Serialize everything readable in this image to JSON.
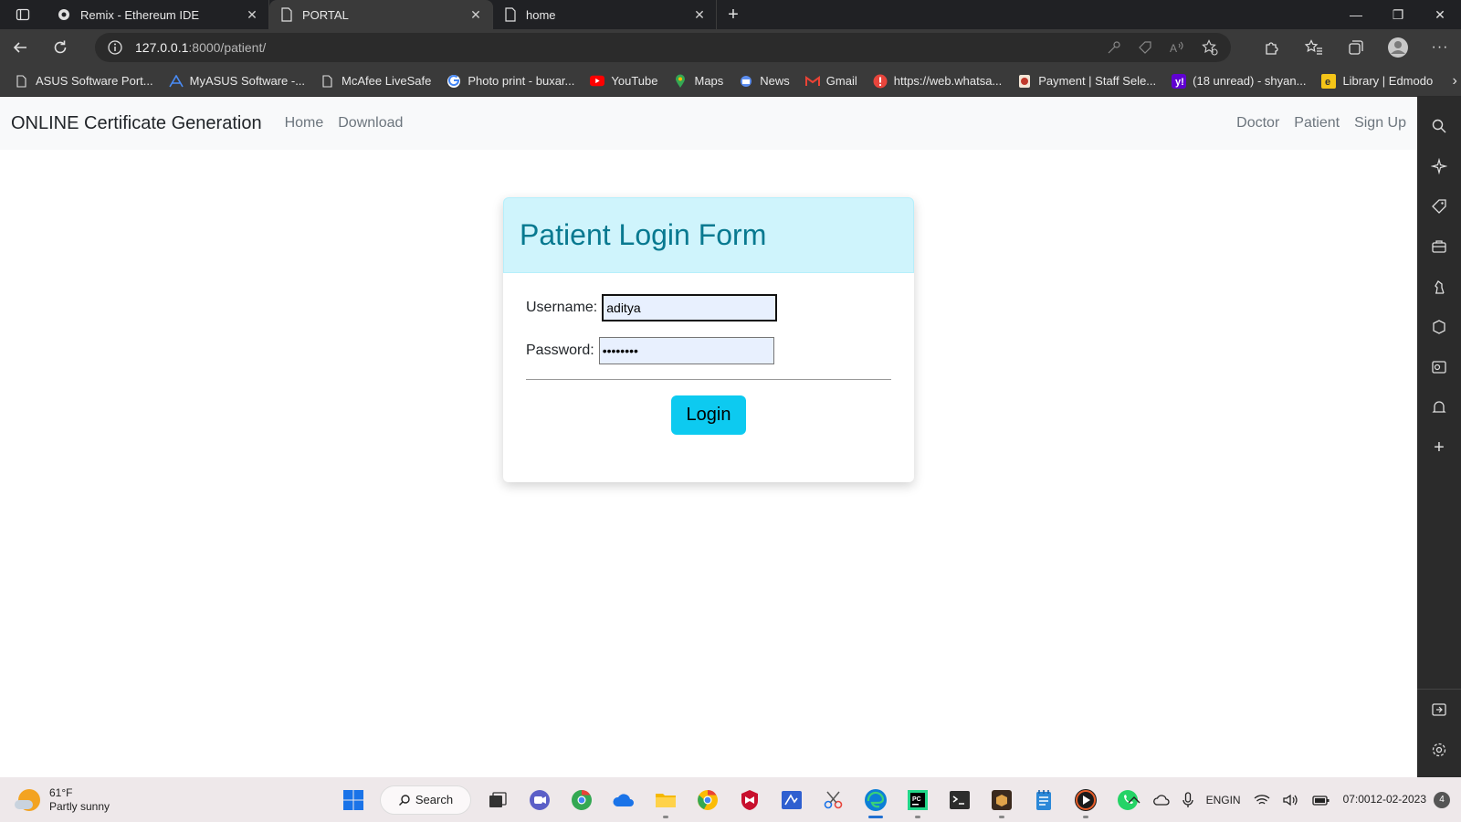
{
  "browser": {
    "tabs": [
      {
        "title": "Remix - Ethereum IDE",
        "active": false
      },
      {
        "title": "PORTAL",
        "active": true
      },
      {
        "title": "home",
        "active": false
      }
    ],
    "address": {
      "host": "127.0.0.1",
      "path": ":8000/patient/"
    },
    "bookmarks": [
      {
        "label": "ASUS Software Port...",
        "icon": "page-icon",
        "color": "#e8e8e8"
      },
      {
        "label": "MyASUS Software -...",
        "icon": "myasus-icon",
        "color": "#4a8cf7"
      },
      {
        "label": "McAfee LiveSafe",
        "icon": "page-icon",
        "color": "#e8e8e8"
      },
      {
        "label": "Photo print - buxar...",
        "icon": "google-icon",
        "color": "#ffffff"
      },
      {
        "label": "YouTube",
        "icon": "youtube-icon",
        "color": "#ff0000"
      },
      {
        "label": "Maps",
        "icon": "maps-icon",
        "color": "#34a853"
      },
      {
        "label": "News",
        "icon": "news-icon",
        "color": "#5b8def"
      },
      {
        "label": "Gmail",
        "icon": "gmail-icon",
        "color": "#ea4335"
      },
      {
        "label": "https://web.whatsa...",
        "icon": "alert-icon",
        "color": "#e8453c"
      },
      {
        "label": "Payment | Staff Sele...",
        "icon": "seal-icon",
        "color": "#c0392b"
      },
      {
        "label": "(18 unread) - shyan...",
        "icon": "yahoo-icon",
        "color": "#6001d2"
      },
      {
        "label": "Library | Edmodo",
        "icon": "edmodo-icon",
        "color": "#f5c518"
      }
    ]
  },
  "navbar": {
    "brand": "ONLINE Certificate Generation",
    "left_links": [
      "Home",
      "Download"
    ],
    "right_links": [
      "Doctor",
      "Patient",
      "Sign Up"
    ]
  },
  "form": {
    "title": "Patient Login Form",
    "username_label": "Username:",
    "username_value": "aditya",
    "password_label": "Password:",
    "password_value": "aditya12",
    "login_label": "Login"
  },
  "taskbar": {
    "weather_temp": "61°F",
    "weather_desc": "Partly sunny",
    "search_label": "Search",
    "lang_line1": "ENG",
    "lang_line2": "IN",
    "time": "07:00",
    "date": "12-02-2023",
    "notifications": "4"
  },
  "colors": {
    "accent": "#0dcaf0",
    "header_bg": "#cff4fc",
    "header_text": "#087990"
  }
}
